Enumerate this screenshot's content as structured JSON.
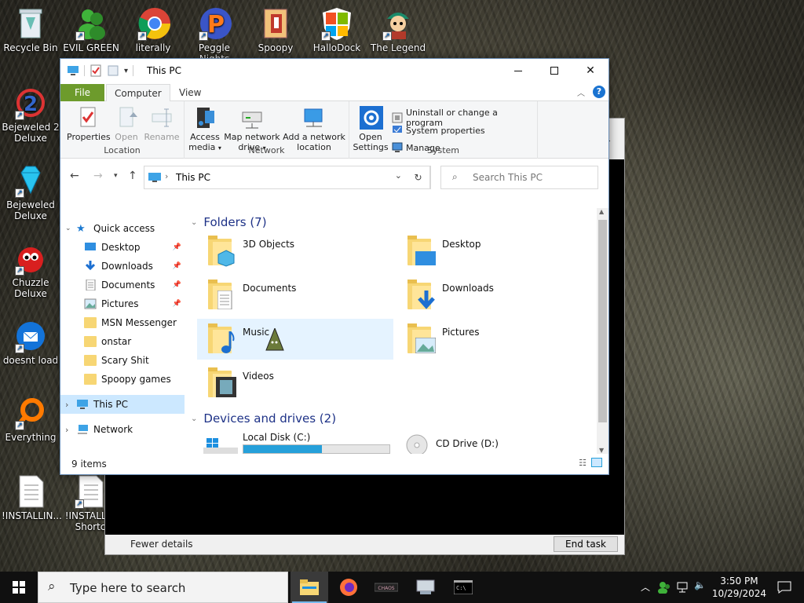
{
  "desktop": {
    "icons": [
      {
        "label": "Recycle Bin",
        "icon": "recycle-bin-icon"
      },
      {
        "label": "EVIL GREEN",
        "icon": "messenger-people-icon"
      },
      {
        "label": "literally",
        "icon": "chrome-icon"
      },
      {
        "label": "Peggle Nights",
        "icon": "peggle-icon"
      },
      {
        "label": "Spoopy",
        "icon": "spoopy-icon"
      },
      {
        "label": "HalloDock",
        "icon": "windows-shield-icon"
      },
      {
        "label": "The Legend",
        "icon": "legend-character-icon"
      },
      {
        "label": "Bejeweled 2 Deluxe",
        "icon": "bejeweled2-icon"
      },
      {
        "label": "Bejeweled Deluxe",
        "icon": "diamond-icon"
      },
      {
        "label": "Chuzzle Deluxe",
        "icon": "chuzzle-icon"
      },
      {
        "label": "doesnt load",
        "icon": "thunderbird-icon"
      },
      {
        "label": "Everything",
        "icon": "everything-search-icon"
      },
      {
        "label": "!INSTALLIN...",
        "icon": "text-file-icon"
      },
      {
        "label": "!INSTALLI - Shortc",
        "icon": "text-file-shortcut-icon"
      }
    ]
  },
  "taskmanager": {
    "fewer_details": "Fewer details",
    "end_task": "End task"
  },
  "explorer": {
    "title": "This PC",
    "tabs": [
      "File",
      "Computer",
      "View"
    ],
    "active_tab": "Computer",
    "ribbon": {
      "location": {
        "label": "Location",
        "buttons": [
          "Properties",
          "Open",
          "Rename"
        ]
      },
      "network": {
        "label": "Network",
        "buttons": [
          "Access media",
          "Map network drive",
          "Add a network location"
        ]
      },
      "system": {
        "label": "System",
        "open_settings": "Open Settings",
        "uninstall": "Uninstall or change a program",
        "system_properties": "System properties",
        "manage": "Manage"
      }
    },
    "address": {
      "path": "This PC",
      "search_placeholder": "Search This PC"
    },
    "navpane": [
      {
        "label": "Quick access",
        "icon": "star-icon",
        "pinned": false
      },
      {
        "label": "Desktop",
        "icon": "desktop-icon",
        "pinned": true
      },
      {
        "label": "Downloads",
        "icon": "download-arrow-icon",
        "pinned": true
      },
      {
        "label": "Documents",
        "icon": "document-icon",
        "pinned": true
      },
      {
        "label": "Pictures",
        "icon": "pictures-icon",
        "pinned": true
      },
      {
        "label": "MSN Messenger",
        "icon": "folder-icon",
        "pinned": false
      },
      {
        "label": "onstar",
        "icon": "folder-icon",
        "pinned": false
      },
      {
        "label": "Scary Shit",
        "icon": "folder-icon",
        "pinned": false
      },
      {
        "label": "Spoopy games",
        "icon": "folder-icon",
        "pinned": false
      },
      {
        "label": "This PC",
        "icon": "computer-icon",
        "pinned": false
      },
      {
        "label": "Network",
        "icon": "network-icon",
        "pinned": false
      }
    ],
    "folders_header": "Folders (7)",
    "folders": [
      "3D Objects",
      "Desktop",
      "Documents",
      "Downloads",
      "Music",
      "Pictures",
      "Videos"
    ],
    "devices_header": "Devices and drives (2)",
    "drives": [
      {
        "label": "Local Disk (C:)",
        "used_fraction": 0.54
      },
      {
        "label": "CD Drive (D:)"
      }
    ],
    "status": "9 items"
  },
  "taskbar": {
    "search_placeholder": "Type here to search",
    "apps": [
      "file-explorer-icon",
      "firefox-icon",
      "game-icon",
      "network-drive-icon",
      "terminal-icon"
    ],
    "time": "3:50 PM",
    "date": "10/29/2024"
  }
}
